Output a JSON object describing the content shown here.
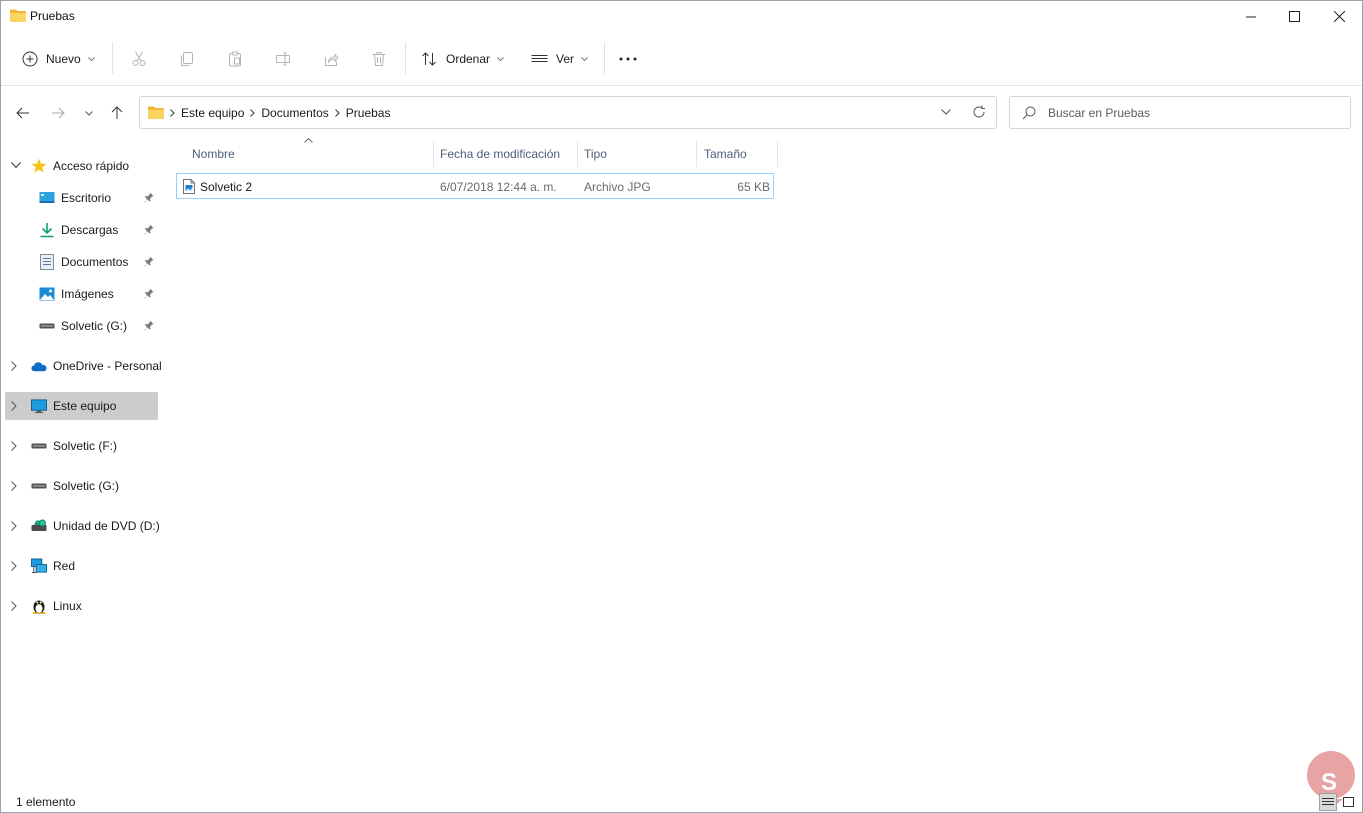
{
  "window": {
    "title": "Pruebas"
  },
  "toolbar": {
    "new_label": "Nuevo",
    "sort_label": "Ordenar",
    "view_label": "Ver",
    "more_label": "···"
  },
  "address": {
    "crumbs": [
      "Este equipo",
      "Documentos",
      "Pruebas"
    ]
  },
  "search": {
    "placeholder": "Buscar en Pruebas"
  },
  "sidebar": {
    "quick_access": "Acceso rápido",
    "pinned": [
      {
        "label": "Escritorio",
        "icon": "desktop-icon"
      },
      {
        "label": "Descargas",
        "icon": "download-icon"
      },
      {
        "label": "Documentos",
        "icon": "documents-icon"
      },
      {
        "label": "Imágenes",
        "icon": "pictures-icon"
      },
      {
        "label": "Solvetic (G:)",
        "icon": "drive-icon"
      }
    ],
    "roots": [
      {
        "label": "OneDrive - Personal",
        "icon": "cloud-icon"
      },
      {
        "label": "Este equipo",
        "icon": "computer-icon",
        "selected": true
      },
      {
        "label": "Solvetic (F:)",
        "icon": "drive-icon"
      },
      {
        "label": "Solvetic (G:)",
        "icon": "drive-icon"
      },
      {
        "label": "Unidad de DVD (D:)",
        "icon": "dvd-icon"
      },
      {
        "label": "Red",
        "icon": "network-icon"
      },
      {
        "label": "Linux",
        "icon": "linux-icon"
      }
    ]
  },
  "columns": {
    "name": "Nombre",
    "date": "Fecha de modificación",
    "type": "Tipo",
    "size": "Tamaño"
  },
  "files": [
    {
      "name": "Solvetic 2",
      "date": "6/07/2018 12:44 a. m.",
      "type": "Archivo JPG",
      "size": "65 KB"
    }
  ],
  "status": {
    "count": "1 elemento"
  },
  "watermark": {
    "text": "S"
  },
  "colors": {
    "folder": "#f8c74a",
    "selection_border": "#99d1ff",
    "header_text": "#4c607a",
    "accent_blue": "#0078d4"
  }
}
